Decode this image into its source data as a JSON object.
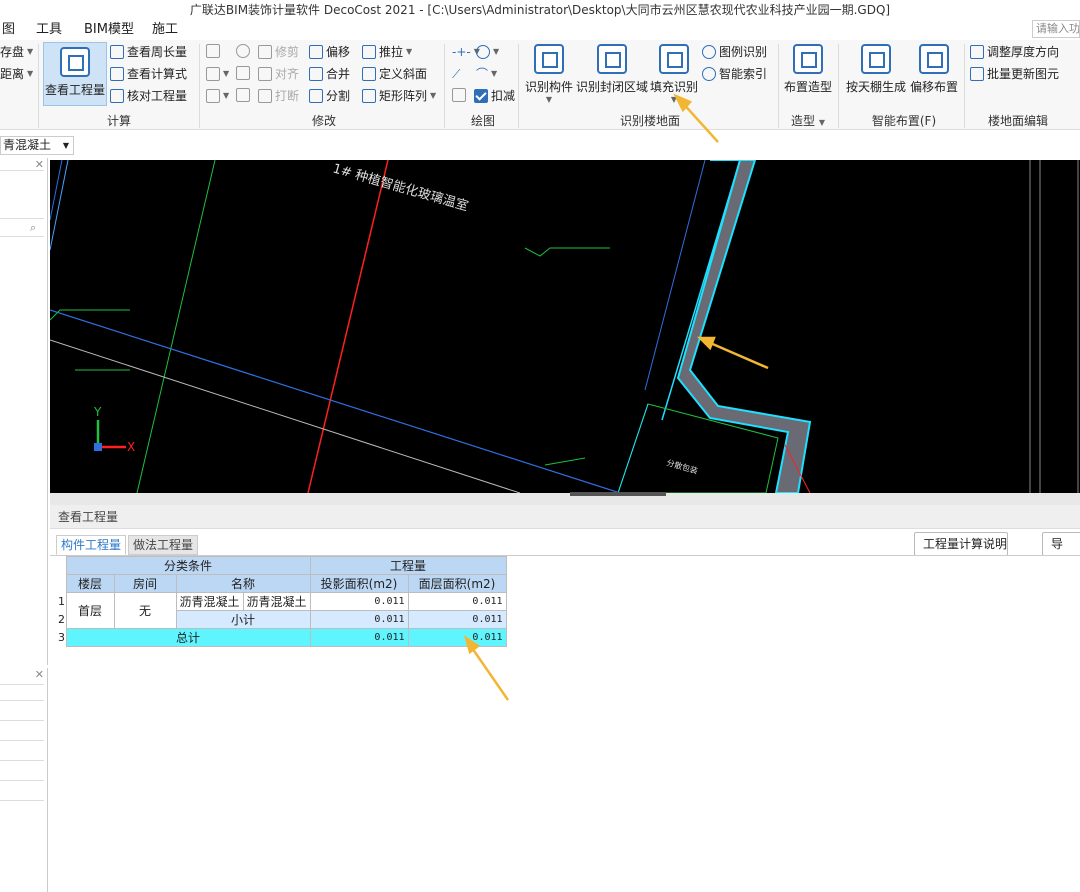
{
  "window": {
    "title": "广联达BIM装饰计量软件 DecoCost 2021 - [C:\\Users\\Administrator\\Desktop\\大同市云州区慧农现代农业科技产业园一期.GDQ]"
  },
  "menu": {
    "items": [
      "图",
      "工具",
      "BIM模型",
      "施工"
    ],
    "search_placeholder": "请输入功"
  },
  "ribbon": {
    "partial_left": [
      "存盘",
      "距离"
    ],
    "calc": {
      "big_button": "查看工程量",
      "items": [
        "查看周长量",
        "查看计算式",
        "核对工程量"
      ],
      "label": "计算"
    },
    "modify": {
      "row1": [
        "修剪",
        "偏移",
        "推拉"
      ],
      "row2": [
        "对齐",
        "合并",
        "定义斜面"
      ],
      "row3": [
        "打断",
        "分割",
        "矩形阵列"
      ],
      "label": "修改"
    },
    "draw": {
      "check_label": "扣减",
      "label": "绘图"
    },
    "recognize": {
      "buttons": [
        "识别构件",
        "识别封闭区域",
        "填充识别"
      ],
      "small": [
        "图例识别",
        "智能索引"
      ],
      "label": "识别楼地面"
    },
    "model": {
      "button": "布置造型",
      "label": "造型"
    },
    "smart": {
      "buttons": [
        "按天棚生成",
        "偏移布置"
      ],
      "label": "智能布置(F)"
    },
    "floor_edit": {
      "items": [
        "调整厚度方向",
        "批量更新图元"
      ],
      "label": "楼地面编辑"
    }
  },
  "layer_select": {
    "value": "青混凝土"
  },
  "canvas": {
    "labels": [
      "1# 种植智能化玻璃温室",
      "分散包装"
    ],
    "axis_x": "X",
    "axis_y": "Y"
  },
  "qty_panel": {
    "title": "查看工程量",
    "tabs": [
      "构件工程量",
      "做法工程量"
    ],
    "explain_button": "工程量计算说明",
    "export_button": "导",
    "table": {
      "group_headers": [
        "分类条件",
        "工程量"
      ],
      "columns": [
        "楼层",
        "房间",
        "名称",
        "投影面积(m2)",
        "面层面积(m2)"
      ],
      "row_numbers": [
        "1",
        "2",
        "3"
      ],
      "floor": "首层",
      "room": "无",
      "name_1": "沥青混凝土",
      "name_2": "沥青混凝土",
      "row1_proj": "0.011",
      "row1_face": "0.011",
      "subtotal_label": "小计",
      "subtotal_proj": "0.011",
      "subtotal_face": "0.011",
      "total_label": "总计",
      "total_proj": "0.011",
      "total_face": "0.011"
    }
  },
  "colors": {
    "accent": "#2e6fb8",
    "total_row": "#5ff5ff",
    "header_cell": "#bcd7f3",
    "annotation": "#f2b632"
  }
}
